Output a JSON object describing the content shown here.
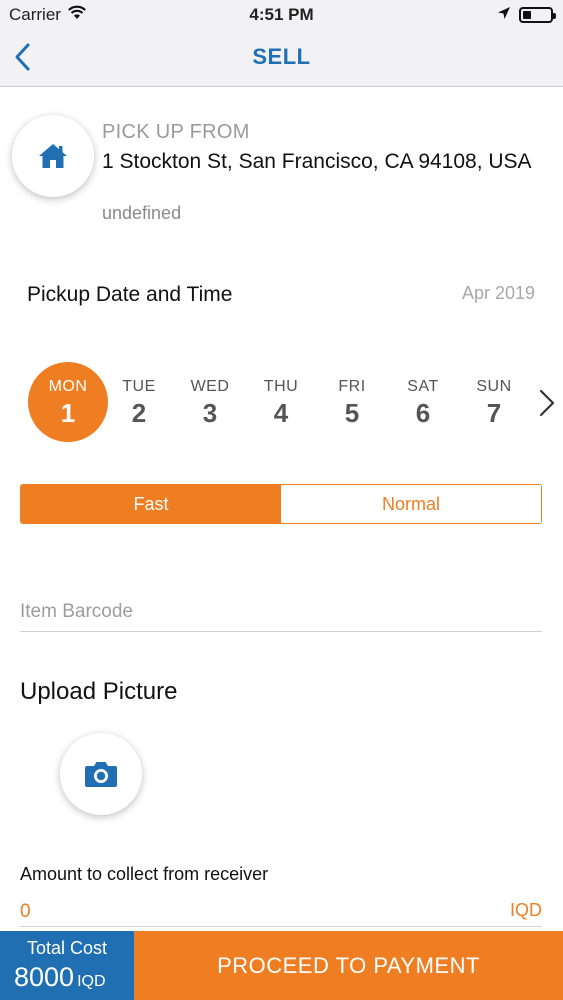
{
  "status_bar": {
    "carrier": "Carrier",
    "time": "4:51 PM",
    "battery_level": 0.3,
    "icons": [
      "wifi-icon",
      "location-arrow-icon",
      "battery-icon"
    ]
  },
  "nav": {
    "title": "SELL",
    "back_icon": "chevron-left-icon"
  },
  "pickup": {
    "label": "PICK UP FROM",
    "address": "1 Stockton St, San Francisco, CA 94108, USA",
    "sub": "undefined",
    "icon": "home-icon"
  },
  "date_section": {
    "title": "Pickup Date and Time",
    "month": "Apr 2019",
    "days": [
      {
        "name": "MON",
        "num": "1",
        "selected": true
      },
      {
        "name": "TUE",
        "num": "2",
        "selected": false
      },
      {
        "name": "WED",
        "num": "3",
        "selected": false
      },
      {
        "name": "THU",
        "num": "4",
        "selected": false
      },
      {
        "name": "FRI",
        "num": "5",
        "selected": false
      },
      {
        "name": "SAT",
        "num": "6",
        "selected": false
      },
      {
        "name": "SUN",
        "num": "7",
        "selected": false
      }
    ]
  },
  "speed_toggle": {
    "options": [
      "Fast",
      "Normal"
    ],
    "selected": "Fast"
  },
  "barcode": {
    "placeholder": "Item Barcode",
    "value": ""
  },
  "upload": {
    "title": "Upload Picture",
    "icon": "camera-icon"
  },
  "amount": {
    "label": "Amount to collect from receiver",
    "value": "0",
    "currency": "IQD"
  },
  "footer": {
    "total_label": "Total Cost",
    "total_value": "8000",
    "total_currency": "IQD",
    "pay_label": "PROCEED TO PAYMENT"
  },
  "colors": {
    "accent_orange": "#ef7d22",
    "brand_blue": "#1f6fb2"
  }
}
